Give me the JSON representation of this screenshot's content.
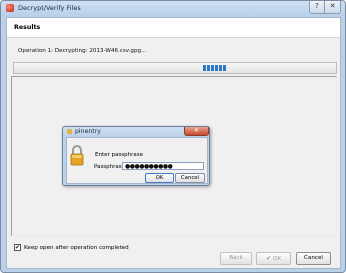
{
  "window": {
    "title": "Decrypt/Verify Files",
    "help_button": "?",
    "close_button": "✕"
  },
  "header": {
    "title": "Results"
  },
  "operation": {
    "text": "Operation 1: Decrypting: 2013-W46.csv.gpg...",
    "progress_indeterminate": true
  },
  "keep_open": {
    "checked": true,
    "mark": "✔",
    "label": "Keep open after operation completed"
  },
  "buttons": {
    "back": "Back",
    "ok": "OK",
    "ok_icon": "✔",
    "cancel": "Cancel"
  },
  "dialog": {
    "title": "pinentry",
    "close": "✕",
    "prompt": "Enter passphrase",
    "field_label": "Passphrase",
    "field_value": "●●●●●●●●●●",
    "ok": "OK",
    "cancel": "Cancel"
  },
  "colors": {
    "progress": "#2f78c8",
    "title_bar": "#b9d1ea",
    "dialog_close": "#c74a30"
  }
}
